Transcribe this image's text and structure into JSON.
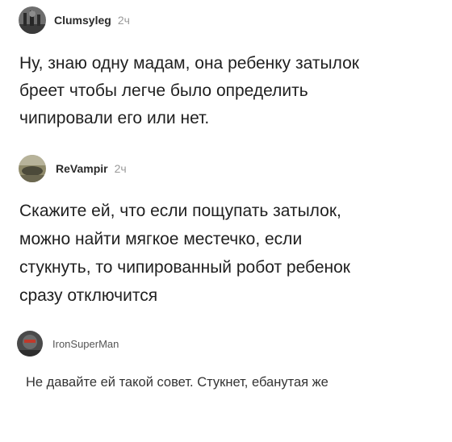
{
  "comments": [
    {
      "username": "Clumsyleg",
      "time": "2ч",
      "avatar": "avatar-icon",
      "text": "Ну, знаю одну мадам, она ребенку затылок\nбреет чтобы легче было определить\nчипировали его или нет."
    },
    {
      "username": "ReVampir",
      "time": "2ч",
      "avatar": "avatar-icon",
      "text": "Скажите ей, что если пощупать затылок,\nможно найти мягкое местечко, если\nстукнуть, то чипированный робот ребенок\nсразу отключится"
    },
    {
      "username": "IronSuperMan",
      "avatar": "avatar-icon",
      "text": "Не давайте ей такой совет. Стукнет, ебанутая же"
    }
  ]
}
